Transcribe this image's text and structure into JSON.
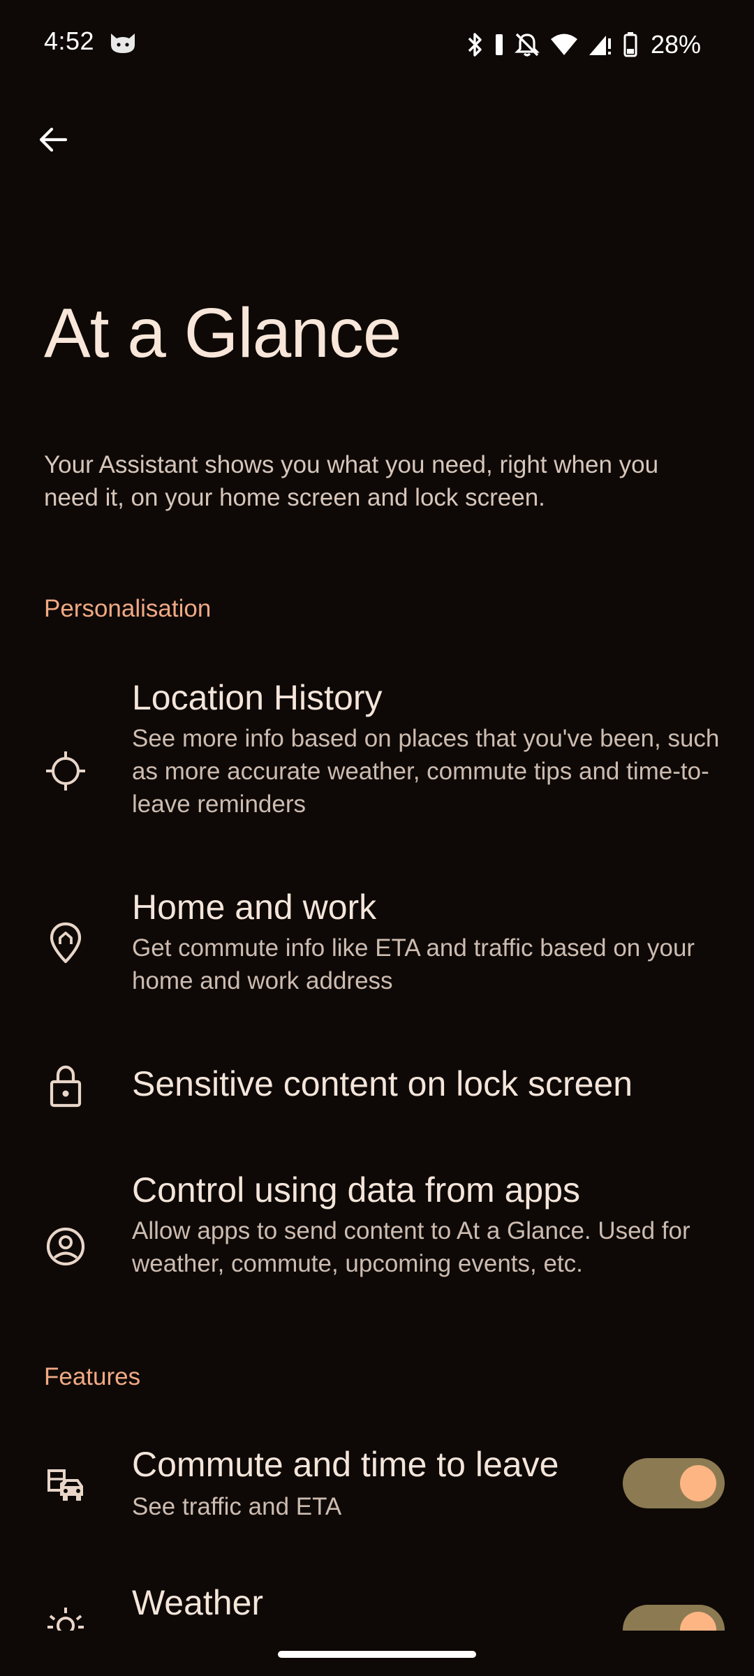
{
  "status": {
    "time": "4:52",
    "battery_percent": "28%"
  },
  "header": {
    "back_icon": "arrow-left-icon",
    "title": "At a Glance",
    "description": "Your Assistant shows you what you need, right when you need it, on your home screen and lock screen."
  },
  "sections": {
    "personalisation": {
      "label": "Personalisation",
      "items": [
        {
          "icon": "location-crosshair-icon",
          "title": "Location History",
          "subtitle": "See more info based on places that you've been, such as more accurate weather, commute tips and time-to-leave reminders"
        },
        {
          "icon": "home-pin-icon",
          "title": "Home and work",
          "subtitle": "Get commute info like ETA and traffic based on your home and work address"
        },
        {
          "icon": "lock-icon",
          "title": "Sensitive content on lock screen"
        },
        {
          "icon": "account-circle-icon",
          "title": "Control using data from apps",
          "subtitle": "Allow apps to send content to At a Glance. Used for weather, commute, upcoming events, etc."
        }
      ]
    },
    "features": {
      "label": "Features",
      "items": [
        {
          "icon": "commute-icon",
          "title": "Commute and time to leave",
          "subtitle": "See traffic and ETA",
          "enabled": true
        },
        {
          "icon": "weather-sun-icon",
          "title": "Weather",
          "enabled": true
        }
      ]
    }
  },
  "colors": {
    "background": "#0e0906",
    "accent": "#f0a985",
    "toggle_track": "#8c7a52",
    "toggle_thumb": "#fdb584"
  }
}
